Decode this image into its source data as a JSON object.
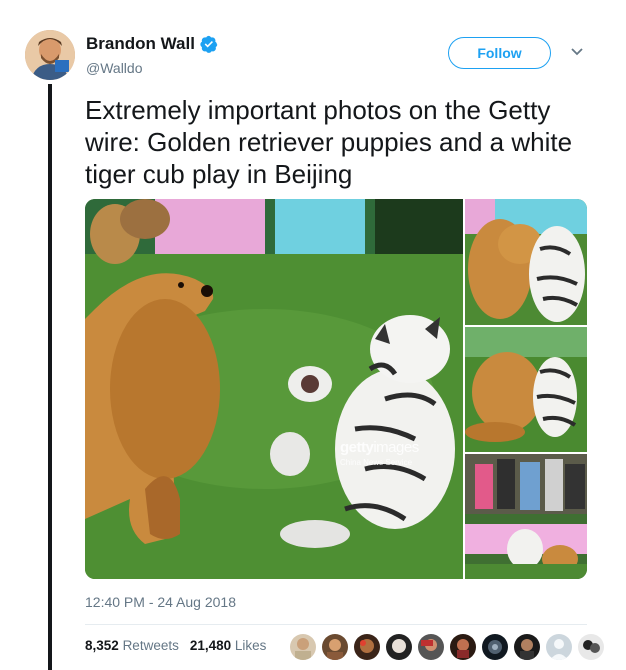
{
  "author": {
    "display_name": "Brandon Wall",
    "handle": "@Walldo",
    "verified": true
  },
  "actions": {
    "follow_label": "Follow",
    "menu_icon": "chevron-down-icon"
  },
  "tweet": {
    "text": "Extremely important photos on the Getty wire: Golden retriever puppies and a white tiger cub play in Beijing",
    "timestamp": "12:40 PM - 24 Aug 2018"
  },
  "media": {
    "watermark_brand_bold": "getty",
    "watermark_brand_light": "images",
    "watermark_credit": "China News Service"
  },
  "stats": {
    "retweets_count": "8,352",
    "retweets_label": "Retweets",
    "likes_count": "21,480",
    "likes_label": "Likes"
  },
  "likers_count": 10,
  "colors": {
    "accent": "#1da1f2",
    "text": "#14171a",
    "muted": "#657786"
  }
}
